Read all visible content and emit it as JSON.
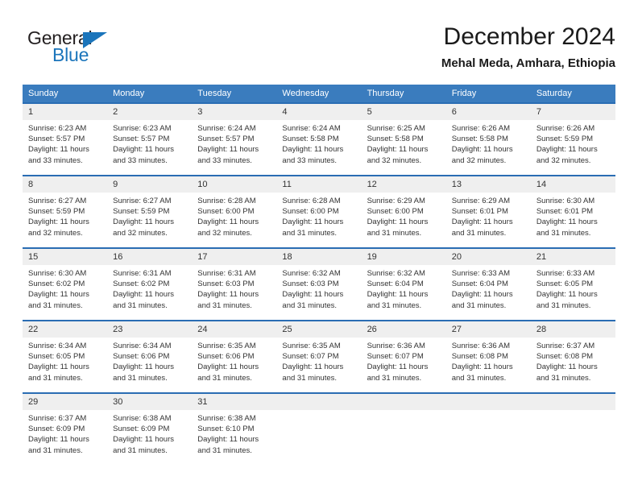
{
  "brand": {
    "name_part1": "General",
    "name_part2": "Blue",
    "accent_color": "#1b75bb"
  },
  "header": {
    "title": "December 2024",
    "subtitle": "Mehal Meda, Amhara, Ethiopia"
  },
  "calendar": {
    "header_bg": "#3a7cbe",
    "daynum_bg": "#efefef",
    "weekday_headers": [
      "Sunday",
      "Monday",
      "Tuesday",
      "Wednesday",
      "Thursday",
      "Friday",
      "Saturday"
    ],
    "weeks": [
      [
        {
          "day": "1",
          "sunrise": "Sunrise: 6:23 AM",
          "sunset": "Sunset: 5:57 PM",
          "daylight_line1": "Daylight: 11 hours",
          "daylight_line2": "and 33 minutes."
        },
        {
          "day": "2",
          "sunrise": "Sunrise: 6:23 AM",
          "sunset": "Sunset: 5:57 PM",
          "daylight_line1": "Daylight: 11 hours",
          "daylight_line2": "and 33 minutes."
        },
        {
          "day": "3",
          "sunrise": "Sunrise: 6:24 AM",
          "sunset": "Sunset: 5:57 PM",
          "daylight_line1": "Daylight: 11 hours",
          "daylight_line2": "and 33 minutes."
        },
        {
          "day": "4",
          "sunrise": "Sunrise: 6:24 AM",
          "sunset": "Sunset: 5:58 PM",
          "daylight_line1": "Daylight: 11 hours",
          "daylight_line2": "and 33 minutes."
        },
        {
          "day": "5",
          "sunrise": "Sunrise: 6:25 AM",
          "sunset": "Sunset: 5:58 PM",
          "daylight_line1": "Daylight: 11 hours",
          "daylight_line2": "and 32 minutes."
        },
        {
          "day": "6",
          "sunrise": "Sunrise: 6:26 AM",
          "sunset": "Sunset: 5:58 PM",
          "daylight_line1": "Daylight: 11 hours",
          "daylight_line2": "and 32 minutes."
        },
        {
          "day": "7",
          "sunrise": "Sunrise: 6:26 AM",
          "sunset": "Sunset: 5:59 PM",
          "daylight_line1": "Daylight: 11 hours",
          "daylight_line2": "and 32 minutes."
        }
      ],
      [
        {
          "day": "8",
          "sunrise": "Sunrise: 6:27 AM",
          "sunset": "Sunset: 5:59 PM",
          "daylight_line1": "Daylight: 11 hours",
          "daylight_line2": "and 32 minutes."
        },
        {
          "day": "9",
          "sunrise": "Sunrise: 6:27 AM",
          "sunset": "Sunset: 5:59 PM",
          "daylight_line1": "Daylight: 11 hours",
          "daylight_line2": "and 32 minutes."
        },
        {
          "day": "10",
          "sunrise": "Sunrise: 6:28 AM",
          "sunset": "Sunset: 6:00 PM",
          "daylight_line1": "Daylight: 11 hours",
          "daylight_line2": "and 32 minutes."
        },
        {
          "day": "11",
          "sunrise": "Sunrise: 6:28 AM",
          "sunset": "Sunset: 6:00 PM",
          "daylight_line1": "Daylight: 11 hours",
          "daylight_line2": "and 31 minutes."
        },
        {
          "day": "12",
          "sunrise": "Sunrise: 6:29 AM",
          "sunset": "Sunset: 6:00 PM",
          "daylight_line1": "Daylight: 11 hours",
          "daylight_line2": "and 31 minutes."
        },
        {
          "day": "13",
          "sunrise": "Sunrise: 6:29 AM",
          "sunset": "Sunset: 6:01 PM",
          "daylight_line1": "Daylight: 11 hours",
          "daylight_line2": "and 31 minutes."
        },
        {
          "day": "14",
          "sunrise": "Sunrise: 6:30 AM",
          "sunset": "Sunset: 6:01 PM",
          "daylight_line1": "Daylight: 11 hours",
          "daylight_line2": "and 31 minutes."
        }
      ],
      [
        {
          "day": "15",
          "sunrise": "Sunrise: 6:30 AM",
          "sunset": "Sunset: 6:02 PM",
          "daylight_line1": "Daylight: 11 hours",
          "daylight_line2": "and 31 minutes."
        },
        {
          "day": "16",
          "sunrise": "Sunrise: 6:31 AM",
          "sunset": "Sunset: 6:02 PM",
          "daylight_line1": "Daylight: 11 hours",
          "daylight_line2": "and 31 minutes."
        },
        {
          "day": "17",
          "sunrise": "Sunrise: 6:31 AM",
          "sunset": "Sunset: 6:03 PM",
          "daylight_line1": "Daylight: 11 hours",
          "daylight_line2": "and 31 minutes."
        },
        {
          "day": "18",
          "sunrise": "Sunrise: 6:32 AM",
          "sunset": "Sunset: 6:03 PM",
          "daylight_line1": "Daylight: 11 hours",
          "daylight_line2": "and 31 minutes."
        },
        {
          "day": "19",
          "sunrise": "Sunrise: 6:32 AM",
          "sunset": "Sunset: 6:04 PM",
          "daylight_line1": "Daylight: 11 hours",
          "daylight_line2": "and 31 minutes."
        },
        {
          "day": "20",
          "sunrise": "Sunrise: 6:33 AM",
          "sunset": "Sunset: 6:04 PM",
          "daylight_line1": "Daylight: 11 hours",
          "daylight_line2": "and 31 minutes."
        },
        {
          "day": "21",
          "sunrise": "Sunrise: 6:33 AM",
          "sunset": "Sunset: 6:05 PM",
          "daylight_line1": "Daylight: 11 hours",
          "daylight_line2": "and 31 minutes."
        }
      ],
      [
        {
          "day": "22",
          "sunrise": "Sunrise: 6:34 AM",
          "sunset": "Sunset: 6:05 PM",
          "daylight_line1": "Daylight: 11 hours",
          "daylight_line2": "and 31 minutes."
        },
        {
          "day": "23",
          "sunrise": "Sunrise: 6:34 AM",
          "sunset": "Sunset: 6:06 PM",
          "daylight_line1": "Daylight: 11 hours",
          "daylight_line2": "and 31 minutes."
        },
        {
          "day": "24",
          "sunrise": "Sunrise: 6:35 AM",
          "sunset": "Sunset: 6:06 PM",
          "daylight_line1": "Daylight: 11 hours",
          "daylight_line2": "and 31 minutes."
        },
        {
          "day": "25",
          "sunrise": "Sunrise: 6:35 AM",
          "sunset": "Sunset: 6:07 PM",
          "daylight_line1": "Daylight: 11 hours",
          "daylight_line2": "and 31 minutes."
        },
        {
          "day": "26",
          "sunrise": "Sunrise: 6:36 AM",
          "sunset": "Sunset: 6:07 PM",
          "daylight_line1": "Daylight: 11 hours",
          "daylight_line2": "and 31 minutes."
        },
        {
          "day": "27",
          "sunrise": "Sunrise: 6:36 AM",
          "sunset": "Sunset: 6:08 PM",
          "daylight_line1": "Daylight: 11 hours",
          "daylight_line2": "and 31 minutes."
        },
        {
          "day": "28",
          "sunrise": "Sunrise: 6:37 AM",
          "sunset": "Sunset: 6:08 PM",
          "daylight_line1": "Daylight: 11 hours",
          "daylight_line2": "and 31 minutes."
        }
      ],
      [
        {
          "day": "29",
          "sunrise": "Sunrise: 6:37 AM",
          "sunset": "Sunset: 6:09 PM",
          "daylight_line1": "Daylight: 11 hours",
          "daylight_line2": "and 31 minutes."
        },
        {
          "day": "30",
          "sunrise": "Sunrise: 6:38 AM",
          "sunset": "Sunset: 6:09 PM",
          "daylight_line1": "Daylight: 11 hours",
          "daylight_line2": "and 31 minutes."
        },
        {
          "day": "31",
          "sunrise": "Sunrise: 6:38 AM",
          "sunset": "Sunset: 6:10 PM",
          "daylight_line1": "Daylight: 11 hours",
          "daylight_line2": "and 31 minutes."
        },
        {
          "day": "",
          "sunrise": "",
          "sunset": "",
          "daylight_line1": "",
          "daylight_line2": ""
        },
        {
          "day": "",
          "sunrise": "",
          "sunset": "",
          "daylight_line1": "",
          "daylight_line2": ""
        },
        {
          "day": "",
          "sunrise": "",
          "sunset": "",
          "daylight_line1": "",
          "daylight_line2": ""
        },
        {
          "day": "",
          "sunrise": "",
          "sunset": "",
          "daylight_line1": "",
          "daylight_line2": ""
        }
      ]
    ]
  }
}
